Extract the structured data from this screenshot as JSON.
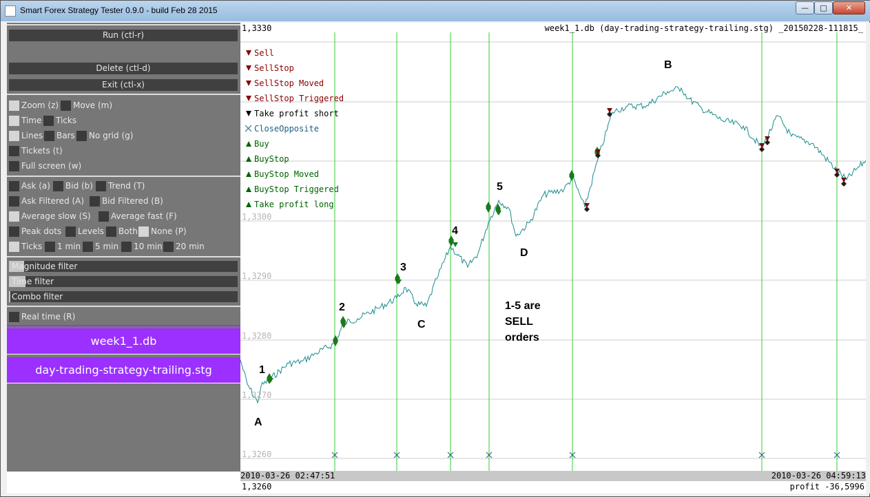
{
  "window": {
    "title": "Smart Forex Strategy Tester 0.9.0 - build Feb 28 2015",
    "min_label": "—",
    "max_label": "□",
    "close_label": "✕"
  },
  "controls": {
    "run": "Run (ctl-r)",
    "delete": "Delete (ctl-d)",
    "exit": "Exit (ctl-x)",
    "zoom": "Zoom (z)",
    "move": "Move (m)",
    "time": "Time",
    "ticks": "Ticks",
    "lines": "Lines",
    "bars": "Bars",
    "nogrid": "No grid (g)",
    "tickets": "Tickets (t)",
    "fullscreen": "Full screen (w)",
    "ask": "Ask (a)",
    "bid": "Bid (b)",
    "trend": "Trend (T)",
    "ask_filtered": "Ask Filtered (A)",
    "bid_filtered": "Bid Filtered (B)",
    "avg_slow": "Average slow (S)",
    "avg_fast": "Average fast (F)",
    "peak_dots": "Peak dots",
    "levels": "Levels",
    "both": "Both",
    "none": "None (P)",
    "ticks2": "Ticks",
    "m1": "1 min",
    "m5": "5 min",
    "m10": "10 min",
    "m20": "20 min",
    "magnitude_filter": "Magnitude filter",
    "time_filter": "Time filter",
    "combo_filter": "Combo filter",
    "real_time": "Real time (R)"
  },
  "files": {
    "db": "week1_1.db",
    "strategy": "day-trading-strategy-trailing.stg"
  },
  "chart": {
    "price_top": "1,3330",
    "header_right": "week1_1.db (day-trading-strategy-trailing.stg) _20150228-111815_",
    "time_start": "2010-03-26 02:47:51",
    "time_end": "2010-03-26 04:59:13",
    "status_left": "1,3260",
    "status_right": "profit -36,5996",
    "y_ticks": [
      "1,3300",
      "1,3290",
      "1,3280",
      "1,3270",
      "1,3260"
    ],
    "legend": [
      {
        "label": "Sell",
        "color": "#8b0000"
      },
      {
        "label": "SellStop",
        "color": "#8b0000"
      },
      {
        "label": "SellStop Moved",
        "color": "#8b0000"
      },
      {
        "label": "SellStop Triggered",
        "color": "#8b0000"
      },
      {
        "label": "Take profit short",
        "color": "#000000"
      },
      {
        "label": "CloseOpposite",
        "color": "#1f5f7f"
      },
      {
        "label": "Buy",
        "color": "#006400"
      },
      {
        "label": "BuyStop",
        "color": "#006400"
      },
      {
        "label": "BuyStop Moved",
        "color": "#006400"
      },
      {
        "label": "BuyStop Triggered",
        "color": "#006400"
      },
      {
        "label": "Take profit long",
        "color": "#006400"
      }
    ],
    "annotations": {
      "A": "A",
      "B": "B",
      "C": "C",
      "D": "D",
      "n1": "1",
      "n2": "2",
      "n3": "3",
      "n4": "4",
      "n5": "5",
      "note1": "1-5 are",
      "note2": "SELL",
      "note3": "orders"
    },
    "colors": {
      "line": "#1a8a8a",
      "vlines": "#33cc33",
      "grid": "#cccccc"
    }
  }
}
